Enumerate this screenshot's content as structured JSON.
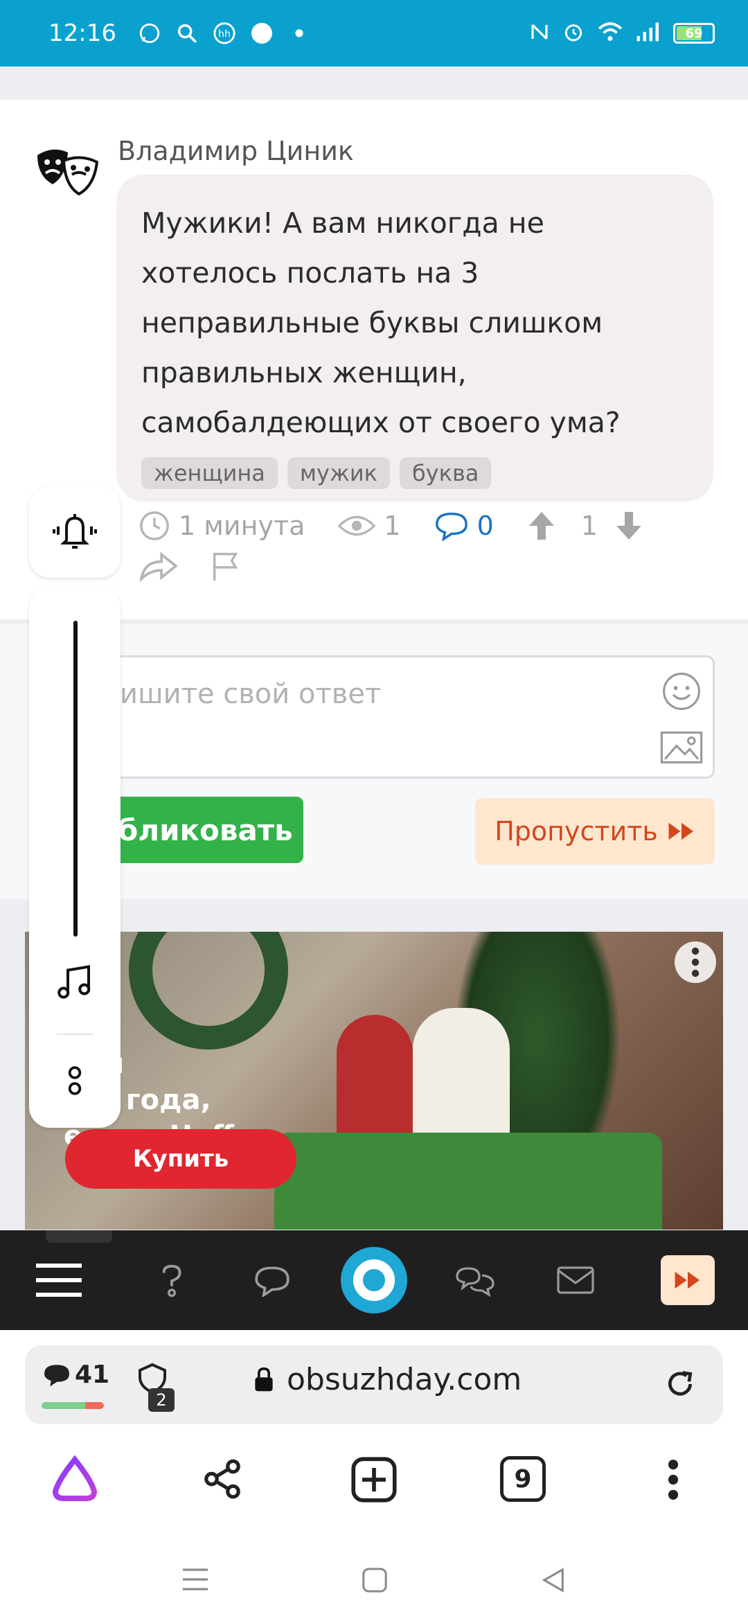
{
  "status_bar": {
    "time": "12:16",
    "battery": "69"
  },
  "post": {
    "author": "Владимир Циник",
    "message": "Мужики! А вам никогда не хотелось послать на 3 неправильные буквы слишком правильных женщин, самобалдеющих от своего ума?",
    "tags": [
      "женщина",
      "мужик",
      "буква"
    ],
    "time_ago": "1 минута",
    "views": "1",
    "comments": "0",
    "rating": "1"
  },
  "reply": {
    "placeholder": "ишите свой ответ",
    "publish_label": "бликовать",
    "skip_label": "Пропустить"
  },
  "ad": {
    "text_line1": "для",
    "text_line2": "ого года,",
    "text_line3": "есть в Hoff",
    "buy_label": "Купить"
  },
  "browser": {
    "messages_count": "41",
    "shield_count": "2",
    "url": "obsuzhday.com",
    "tabs_count": "9"
  },
  "colors": {
    "status_bar": "#0aa1cf",
    "publish": "#34b24a",
    "skip_bg": "#ffe6cf",
    "skip_text": "#d3471b",
    "accent": "#1fa7d6"
  }
}
